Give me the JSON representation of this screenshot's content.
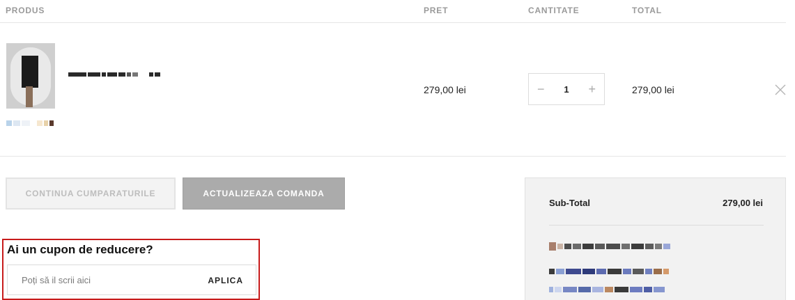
{
  "table": {
    "headers": {
      "product": "PRODUS",
      "price": "PRET",
      "quantity": "CANTITATE",
      "total": "TOTAL"
    },
    "items": [
      {
        "price": "279,00 lei",
        "quantity": "1",
        "total": "279,00 lei"
      }
    ]
  },
  "icons": {
    "decrement": "minus-icon",
    "increment": "plus-icon",
    "remove": "close-icon"
  },
  "actions": {
    "continue_label": "CONTINUA CUMPARATURILE",
    "update_label": "ACTUALIZEAZA COMANDA"
  },
  "coupon": {
    "title": "Ai un cupon de reducere?",
    "placeholder": "Poți să il scrii aici",
    "apply_label": "APLICA",
    "highlight_color": "#c71b1b"
  },
  "summary": {
    "subtotal_label": "Sub-Total",
    "subtotal_value": "279,00 lei"
  }
}
